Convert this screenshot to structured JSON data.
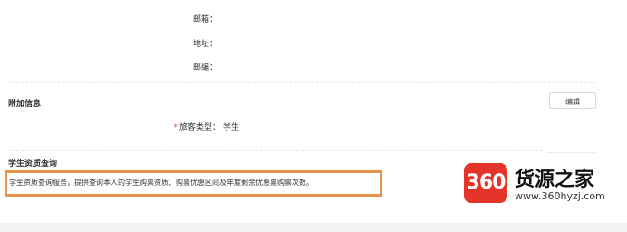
{
  "contact": {
    "email_label": "邮箱：",
    "address_label": "地址：",
    "postcode_label": "邮编："
  },
  "additional": {
    "title": "附加信息",
    "edit_label": "编辑",
    "passenger_type_label": "旅客类型：",
    "passenger_type_value": "学生",
    "required_mark": "*"
  },
  "student": {
    "title": "学生资质查询",
    "description": "学生资质查询服务，提供查询本人的学生购票资质、购票优惠区间及年度剩余优惠票购票次数。"
  },
  "watermark": {
    "badge": "360",
    "name": "货源之家",
    "url": "www.360hyzj.com"
  }
}
